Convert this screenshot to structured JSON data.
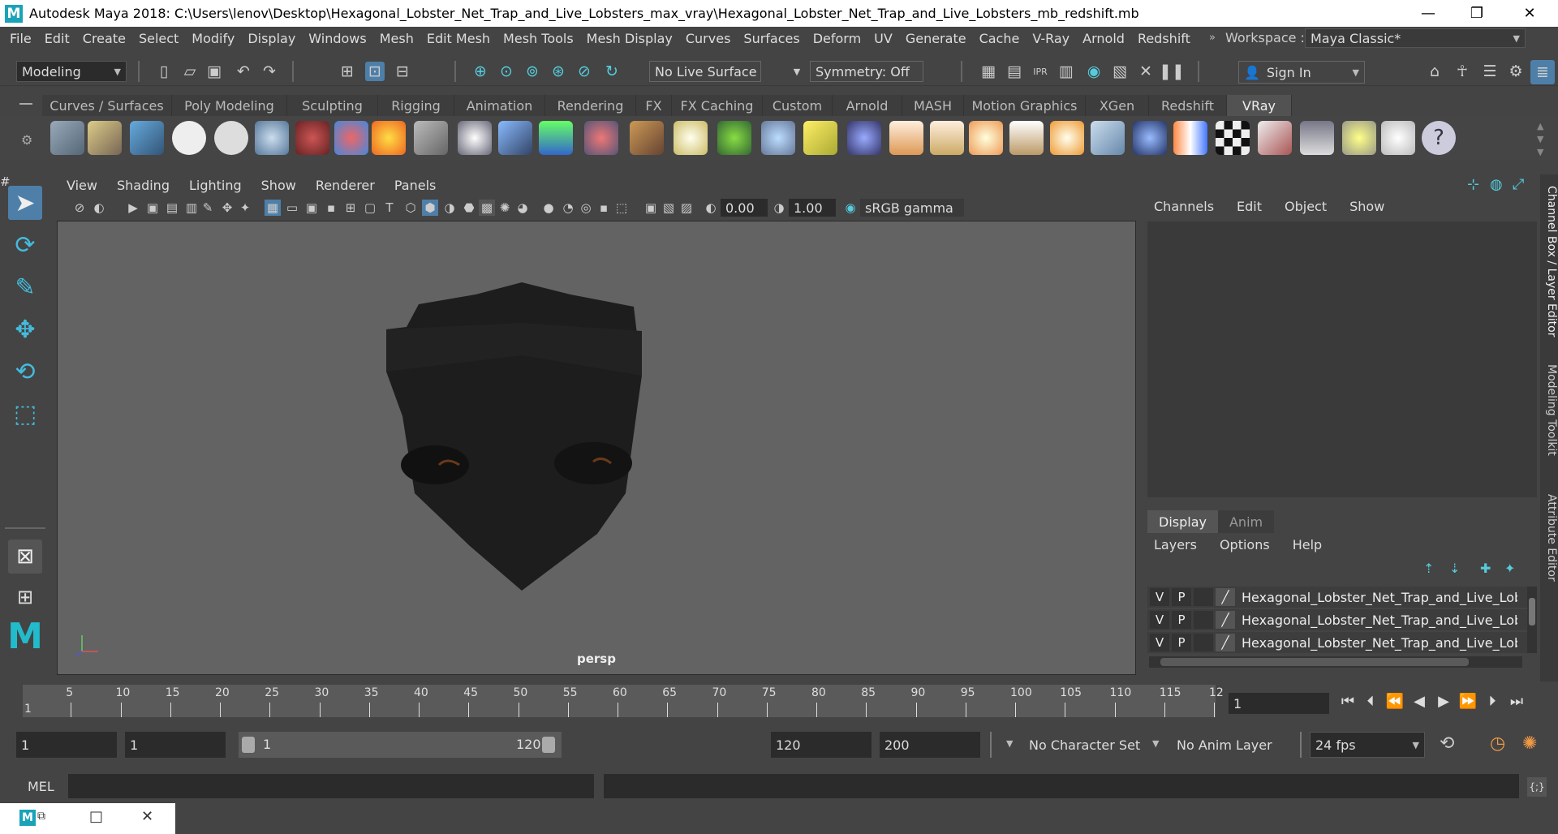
{
  "window": {
    "title": "Autodesk Maya 2018: C:\\Users\\lenov\\Desktop\\Hexagonal_Lobster_Net_Trap_and_Live_Lobsters_max_vray\\Hexagonal_Lobster_Net_Trap_and_Live_Lobsters_mb_redshift.mb",
    "logo": "M",
    "minimize": "—",
    "maximize": "❐",
    "close": "✕"
  },
  "menu": [
    "File",
    "Edit",
    "Create",
    "Select",
    "Modify",
    "Display",
    "Windows",
    "Mesh",
    "Edit Mesh",
    "Mesh Tools",
    "Mesh Display",
    "Curves",
    "Surfaces",
    "Deform",
    "UV",
    "Generate",
    "Cache",
    "V-Ray",
    "Arnold",
    "Redshift"
  ],
  "workspace": {
    "label": "Workspace :",
    "value": "Maya Classic*"
  },
  "statusline": {
    "mode": "Modeling",
    "live_surface": "No Live Surface",
    "symmetry": "Symmetry: Off",
    "sign_in": "Sign In"
  },
  "shelf_tabs": [
    "Curves / Surfaces",
    "Poly Modeling",
    "Sculpting",
    "Rigging",
    "Animation",
    "Rendering",
    "FX",
    "FX Caching",
    "Custom",
    "Arnold",
    "MASH",
    "Motion Graphics",
    "XGen",
    "Redshift",
    "VRay"
  ],
  "shelf_active": "VRay",
  "panel_menu": [
    "View",
    "Shading",
    "Lighting",
    "Show",
    "Renderer",
    "Panels"
  ],
  "panel_fields": {
    "exposure": "0.00",
    "gamma": "1.00",
    "colorspace": "sRGB gamma"
  },
  "viewport": {
    "camera": "persp"
  },
  "channel_menu": [
    "Channels",
    "Edit",
    "Object",
    "Show"
  ],
  "layer_tabs": [
    "Display",
    "Anim"
  ],
  "layer_menu": [
    "Layers",
    "Options",
    "Help"
  ],
  "layers": [
    {
      "v": "V",
      "p": "P",
      "name": "Hexagonal_Lobster_Net_Trap_and_Live_Lobste"
    },
    {
      "v": "V",
      "p": "P",
      "name": "Hexagonal_Lobster_Net_Trap_and_Live_Lobste"
    },
    {
      "v": "V",
      "p": "P",
      "name": "Hexagonal_Lobster_Net_Trap_and_Live_Lobste"
    }
  ],
  "side_tabs": [
    "Channel Box / Layer Editor",
    "Modeling Toolkit",
    "Attribute Editor"
  ],
  "timeline": {
    "ticks": [
      "5",
      "10",
      "15",
      "20",
      "25",
      "30",
      "35",
      "40",
      "45",
      "50",
      "55",
      "60",
      "65",
      "70",
      "75",
      "80",
      "85",
      "90",
      "95",
      "100",
      "105",
      "110",
      "115",
      "12"
    ],
    "start_marker": "1",
    "current_frame": "1"
  },
  "range": {
    "start": "1",
    "playback_start": "1",
    "slider_start": "1",
    "slider_end": "120",
    "playback_end": "120",
    "end": "200",
    "character_set": "No Character Set",
    "anim_layer": "No Anim Layer",
    "fps": "24 fps"
  },
  "cmdline": {
    "label": "MEL"
  }
}
